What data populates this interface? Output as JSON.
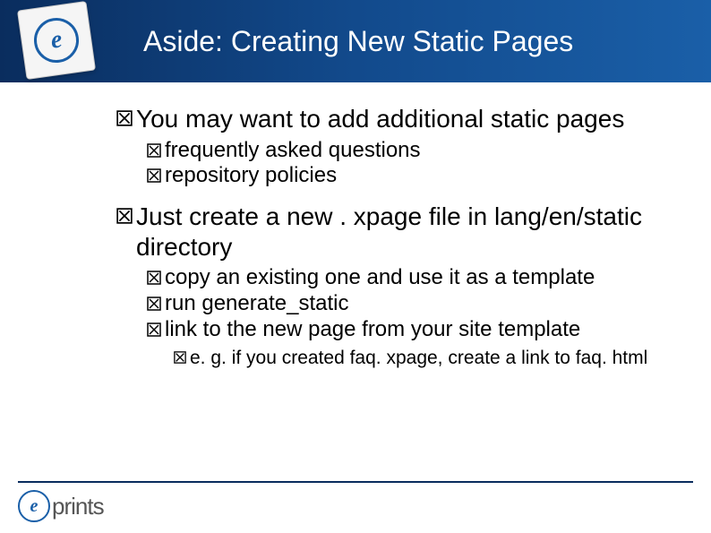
{
  "header": {
    "logo_letter": "e",
    "title": "Aside: Creating New Static Pages"
  },
  "content": {
    "items": [
      {
        "text": "You may want to add additional static pages",
        "children": [
          {
            "text": "frequently asked questions"
          },
          {
            "text": "repository policies"
          }
        ]
      },
      {
        "text": "Just create a new . xpage file in lang/en/static directory",
        "children": [
          {
            "text": "copy an existing one and use it as a template"
          },
          {
            "text": "run generate_static"
          },
          {
            "text": "link to the new page from your site template",
            "children": [
              {
                "text": "e. g. if you created faq. xpage, create a link to faq. html"
              }
            ]
          }
        ]
      }
    ]
  },
  "footer": {
    "logo_letter": "e",
    "logo_text": "prints"
  }
}
